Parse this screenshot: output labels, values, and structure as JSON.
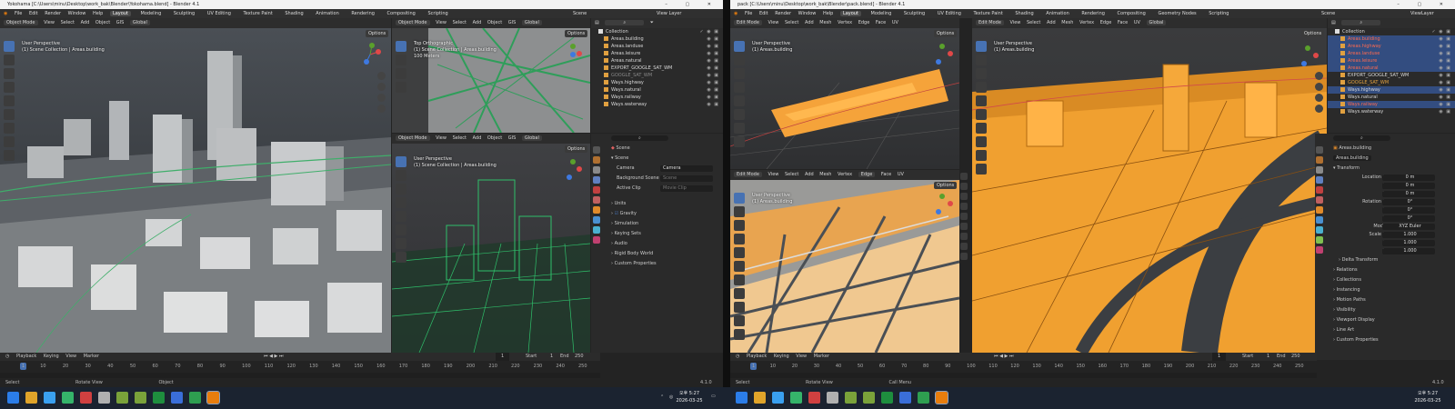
{
  "left_window": {
    "title": "Yokohama [C:\\Users\\minu\\Desktop\\work_bak\\Blender\\Yokohama.blend] - Blender 4.1",
    "menu": [
      "File",
      "Edit",
      "Render",
      "Window",
      "Help"
    ],
    "workspaces": [
      "Layout",
      "Modeling",
      "Sculpting",
      "UV Editing",
      "Texture Paint",
      "Shading",
      "Animation",
      "Rendering",
      "Compositing",
      "Scripting"
    ],
    "active_workspace": "Layout",
    "scene_label": "Scene",
    "view_layer_label": "View Layer",
    "viewport_main": {
      "header": [
        "Object Mode",
        "View",
        "Select",
        "Add",
        "Object",
        "GIS"
      ],
      "transform": "Global",
      "options": "Options",
      "label1": "User Perspective",
      "label2": "(1) Scene Collection | Areas.building"
    },
    "viewport_top": {
      "header": [
        "Object Mode",
        "View",
        "Select",
        "Add",
        "Object",
        "GIS"
      ],
      "transform": "Global",
      "options": "Options",
      "label1": "Top Orthographic",
      "label2": "(1) Scene Collection | Areas.building",
      "label3": "100 Meters"
    },
    "viewport_green": {
      "header": [
        "Object Mode",
        "View",
        "Select",
        "Add",
        "Object",
        "GIS"
      ],
      "transform": "Global",
      "options": "Options",
      "label1": "User Perspective",
      "label2": "(1) Scene Collection | Areas.building"
    },
    "outliner": {
      "root": "Collection",
      "items": [
        "Areas.building",
        "Areas.landuse",
        "Areas.leisure",
        "Areas.natural",
        "EXPORT_GOOGLE_SAT_WM",
        "GOOGLE_SAT_WM",
        "Ways.highway",
        "Ways.natural",
        "Ways.railway",
        "Ways.waterway"
      ]
    },
    "properties": {
      "search_placeholder": "",
      "scene_name": "Scene",
      "section": "Scene",
      "camera_label": "Camera",
      "camera_value": "Camera",
      "background_label": "Background Scene",
      "background_value": "Scene",
      "clip_label": "Active Clip",
      "clip_value": "Movie Clip",
      "panels": [
        "Units",
        "Gravity",
        "Simulation",
        "Keying Sets",
        "Audio",
        "Rigid Body World",
        "Custom Properties"
      ]
    },
    "timeline": {
      "menu": [
        "Playback",
        "Keying",
        "View",
        "Marker"
      ],
      "current_frame": "1",
      "start_label": "Start",
      "start_value": "1",
      "end_label": "End",
      "end_value": "250",
      "ticks": [
        "1",
        "10",
        "20",
        "30",
        "40",
        "50",
        "60",
        "70",
        "80",
        "90",
        "100",
        "110",
        "120",
        "130",
        "140",
        "150",
        "160",
        "170",
        "180",
        "190",
        "200",
        "210",
        "220",
        "230",
        "240",
        "250"
      ]
    },
    "status": [
      "Select",
      "Rotate View",
      "Object"
    ],
    "version": "4.1.0"
  },
  "right_window": {
    "title": "pack [C:\\Users\\minu\\Desktop\\work_bak\\Blender\\pack.blend] - Blender 4.1",
    "menu": [
      "File",
      "Edit",
      "Render",
      "Window",
      "Help"
    ],
    "workspaces": [
      "Layout",
      "Modeling",
      "Sculpting",
      "UV Editing",
      "Texture Paint",
      "Shading",
      "Animation",
      "Rendering",
      "Compositing",
      "Geometry Nodes",
      "Scripting"
    ],
    "active_workspace": "Layout",
    "scene_label": "Scene",
    "view_layer_label": "ViewLayer",
    "viewport_top": {
      "header": [
        "Edit Mode",
        "View",
        "Select",
        "Add",
        "Mesh",
        "Vertex",
        "Edge",
        "Face",
        "UV"
      ],
      "transform": "Global",
      "options": "Options",
      "label1": "User Perspective",
      "label2": "(1) Areas.building"
    },
    "viewport_bottom": {
      "header": [
        "Edit Mode",
        "View",
        "Select",
        "Add",
        "Mesh",
        "Vertex",
        "Edge",
        "Face",
        "UV"
      ],
      "options": "Options",
      "label1": "User Perspective",
      "label2": "(1) Areas.building"
    },
    "viewport_big": {
      "header": [
        "Edit Mode",
        "View",
        "Select",
        "Add",
        "Mesh",
        "Vertex",
        "Edge",
        "Face",
        "UV"
      ],
      "transform": "Global",
      "options": "Options",
      "label1": "User Perspective",
      "label2": "(1) Areas.building"
    },
    "outliner": {
      "root": "Collection",
      "items": [
        "Areas.building",
        "Areas.highway",
        "Areas.landuse",
        "Areas.leisure",
        "Areas.natural",
        "EXPORT_GOOGLE_SAT_WM",
        "GOOGLE_SAT_WM",
        "Ways.highway",
        "Ways.natural",
        "Ways.railway",
        "Ways.waterway"
      ]
    },
    "properties": {
      "object_name": "Areas.building",
      "mesh_name": "Areas.building",
      "transform_label": "Transform",
      "rows": [
        {
          "label": "Location X",
          "value": "0 m"
        },
        {
          "label": "Y",
          "value": "0 m"
        },
        {
          "label": "Z",
          "value": "0 m"
        },
        {
          "label": "Rotation X",
          "value": "0°"
        },
        {
          "label": "Y",
          "value": "0°"
        },
        {
          "label": "Z",
          "value": "0°"
        },
        {
          "label": "Mode",
          "value": "XYZ Euler"
        },
        {
          "label": "Scale X",
          "value": "1.000"
        },
        {
          "label": "Y",
          "value": "1.000"
        },
        {
          "label": "Z",
          "value": "1.000"
        }
      ],
      "panels": [
        "Delta Transform",
        "Relations",
        "Collections",
        "Instancing",
        "Motion Paths",
        "Visibility",
        "Viewport Display",
        "Line Art",
        "Custom Properties"
      ]
    },
    "timeline": {
      "menu": [
        "Playback",
        "Keying",
        "View",
        "Marker"
      ],
      "current_frame": "1",
      "start_label": "Start",
      "start_value": "1",
      "end_label": "End",
      "end_value": "250",
      "ticks": [
        "1",
        "10",
        "20",
        "30",
        "40",
        "50",
        "60",
        "70",
        "80",
        "90",
        "100",
        "110",
        "120",
        "130",
        "140",
        "150",
        "160",
        "170",
        "180",
        "190",
        "200",
        "210",
        "220",
        "230",
        "240",
        "250"
      ]
    },
    "status": [
      "Select",
      "Rotate View",
      "Call Menu"
    ],
    "version": "4.1.0"
  },
  "taskbar": {
    "time_left": "오후 5:27",
    "date_left": "2026-03-25",
    "time_right": "오후 5:27",
    "date_right": "2026-03-25"
  }
}
